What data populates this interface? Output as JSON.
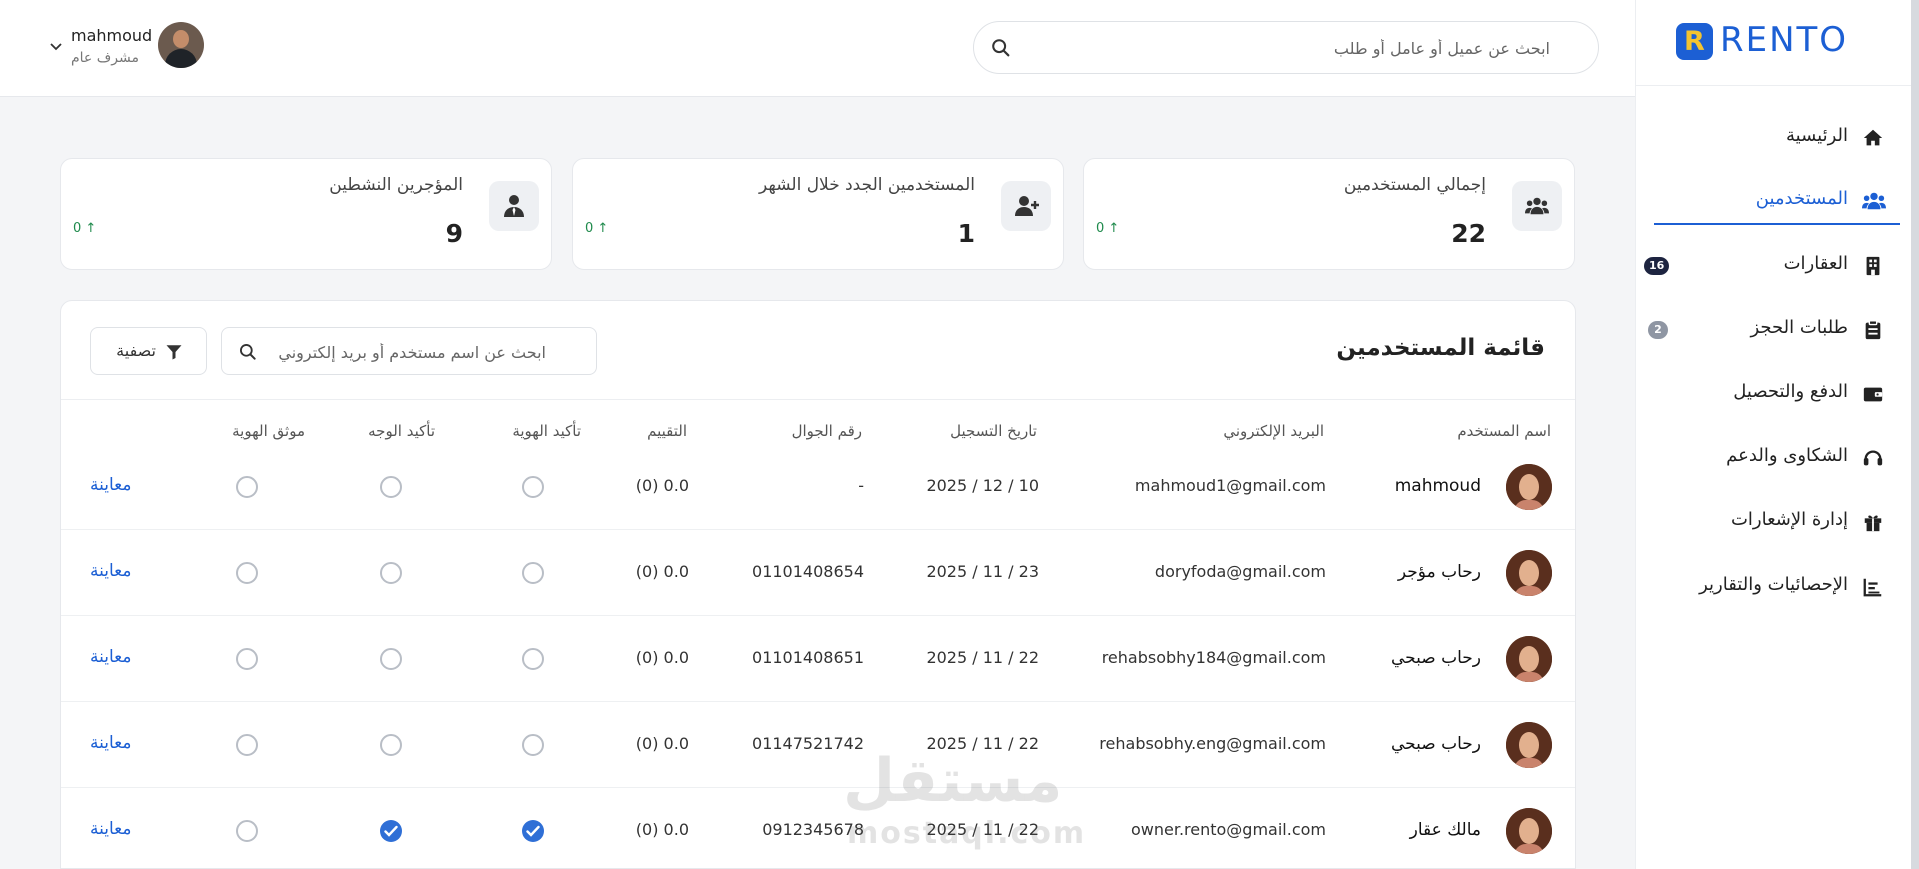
{
  "header": {
    "user_name": "mahmoud",
    "user_role": "مشرف عام",
    "search_placeholder": "ابحث عن عميل أو عامل أو طلب"
  },
  "sidebar": {
    "logo_text": "RENTO",
    "items": [
      {
        "label": "الرئيسية",
        "icon": "home-icon"
      },
      {
        "label": "المستخدمين",
        "icon": "users-icon",
        "active": true
      },
      {
        "label": "العقارات",
        "icon": "building-icon",
        "badge": "16"
      },
      {
        "label": "طلبات الحجز",
        "icon": "clipboard-icon",
        "badge": "2"
      },
      {
        "label": "الدفع والتحصيل",
        "icon": "wallet-icon"
      },
      {
        "label": "الشكاوى والدعم",
        "icon": "headset-icon"
      },
      {
        "label": "إدارة الإشعارات",
        "icon": "gift-icon"
      },
      {
        "label": "الإحصائيات والتقارير",
        "icon": "chart-icon"
      }
    ]
  },
  "stats": [
    {
      "title": "إجمالي المستخدمين",
      "value": "22",
      "trend": "0",
      "icon": "users-icon"
    },
    {
      "title": "المستخدمين الجدد خلال الشهر",
      "value": "1",
      "trend": "0",
      "icon": "user-plus-icon"
    },
    {
      "title": "المؤجرين النشطين",
      "value": "9",
      "trend": "0",
      "icon": "user-tie-icon"
    }
  ],
  "users_panel": {
    "title": "قائمة المستخدمين",
    "search_placeholder": "ابحث عن اسم مستخدم أو بريد إلكتروني",
    "filter_label": "تصفية",
    "columns": {
      "name": "اسم المستخدم",
      "email": "البريد الإلكتروني",
      "registered": "تاريخ التسجيل",
      "phone": "رقم الجوال",
      "rating": "التقييم",
      "id_confirm": "تأكيد الهوية",
      "face_confirm": "تأكيد الوجه",
      "id_verified": "موثق الهوية"
    },
    "rows": [
      {
        "name": "mahmoud",
        "email": "mahmoud1@gmail.com",
        "registered": "2025 / 12 / 10",
        "phone": "-",
        "rating": "(0) 0.0",
        "id_confirm": false,
        "face_confirm": false,
        "id_verified": false,
        "action": "معاينة"
      },
      {
        "name": "رحاب مؤجر",
        "email": "doryfoda@gmail.com",
        "registered": "2025 / 11 / 23",
        "phone": "01101408654",
        "rating": "(0) 0.0",
        "id_confirm": false,
        "face_confirm": false,
        "id_verified": false,
        "action": "معاينة"
      },
      {
        "name": "رحاب صبحي",
        "email": "rehabsobhy184@gmail.com",
        "registered": "2025 / 11 / 22",
        "phone": "01101408651",
        "rating": "(0) 0.0",
        "id_confirm": false,
        "face_confirm": false,
        "id_verified": false,
        "action": "معاينة"
      },
      {
        "name": "رحاب صبحي",
        "email": "rehabsobhy.eng@gmail.com",
        "registered": "2025 / 11 / 22",
        "phone": "01147521742",
        "rating": "(0) 0.0",
        "id_confirm": false,
        "face_confirm": false,
        "id_verified": false,
        "action": "معاينة"
      },
      {
        "name": "مالك عقار",
        "email": "owner.rento@gmail.com",
        "registered": "2025 / 11 / 22",
        "phone": "0912345678",
        "rating": "(0) 0.0",
        "id_confirm": true,
        "face_confirm": true,
        "id_verified": false,
        "action": "معاينة"
      }
    ]
  },
  "watermark": {
    "arabic": "مستقل",
    "latin": "mostaql.com"
  },
  "colors": {
    "accent": "#1c5fd4",
    "logo_yellow": "#f4c430",
    "trend_up": "#1f8a4c",
    "check_blue": "#2f6fd6"
  }
}
